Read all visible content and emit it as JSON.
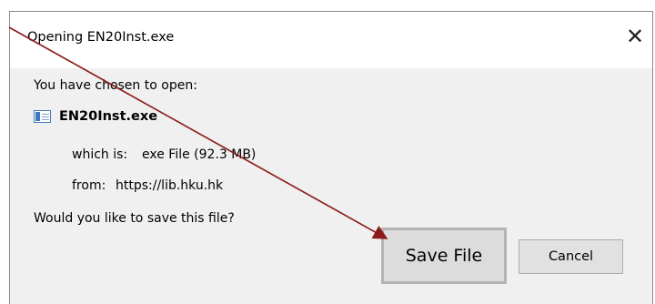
{
  "dialog": {
    "title": "Opening EN20Inst.exe",
    "close_glyph": "✕",
    "intro": "You have chosen to open:",
    "file": {
      "icon": "exe-file-icon",
      "name": "EN20Inst.exe",
      "type_label": "which is:",
      "type_value": "exe File (92.3 MB)",
      "from_label": "from:",
      "from_value": "https://lib.hku.hk"
    },
    "question": "Would you like to save this file?",
    "buttons": {
      "save": "Save File",
      "cancel": "Cancel"
    }
  },
  "annotation": {
    "arrow_color": "#8b1a1a"
  }
}
